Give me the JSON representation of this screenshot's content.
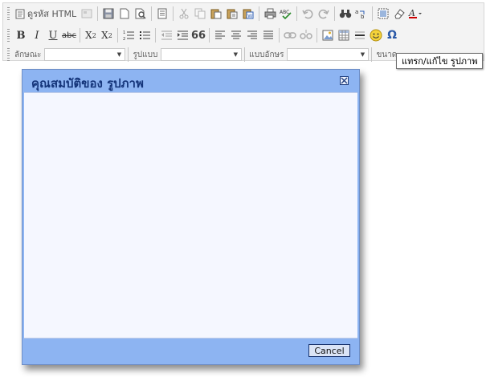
{
  "toolbar": {
    "source_label": "ดูรหัส HTML",
    "bold_label": "B",
    "italic_label": "I",
    "underline_label": "U",
    "strike_label": "abc",
    "subscript_label": "X",
    "subscript_mark": "2",
    "superscript_label": "X",
    "superscript_mark": "2",
    "blockquote_label": "66",
    "special_char_label": "Ω",
    "style_label": "ลักษณะ",
    "format_label": "รูปแบบ",
    "font_label": "แบบอักษร",
    "size_label": "ขนาด",
    "icons": {
      "source": "document-code-icon",
      "save": "floppy-disk-icon",
      "new_page": "new-page-icon",
      "preview": "preview-icon",
      "templates": "templates-icon",
      "cut": "scissors-icon",
      "copy": "copy-icon",
      "paste": "paste-icon",
      "paste_text": "paste-text-icon",
      "paste_word": "paste-word-icon",
      "print": "printer-icon",
      "spellcheck": "spellcheck-icon",
      "undo": "undo-icon",
      "redo": "redo-icon",
      "find": "binoculars-icon",
      "replace": "replace-icon",
      "select_all": "select-all-icon",
      "remove_format": "eraser-icon",
      "text_color": "text-color-icon",
      "numbered_list": "numbered-list-icon",
      "bulleted_list": "bulleted-list-icon",
      "outdent": "outdent-icon",
      "indent": "indent-icon",
      "align_left": "align-left-icon",
      "align_center": "align-center-icon",
      "align_right": "align-right-icon",
      "justify": "justify-icon",
      "link": "link-icon",
      "unlink": "unlink-icon",
      "image": "image-icon",
      "table": "table-icon",
      "horizontal_rule": "horizontal-rule-icon",
      "smiley": "smiley-icon"
    }
  },
  "tooltip": {
    "text": "แทรก/แก้ไข รูปภาพ"
  },
  "dialog": {
    "title": "คุณสมบัติของ รูปภาพ",
    "cancel_label": "Cancel"
  },
  "colors": {
    "dialog_frame": "#8db4f2",
    "dialog_title": "#15357a",
    "dialog_body": "#f5f7ff",
    "toolbar_bg": "#f3f3f3"
  }
}
